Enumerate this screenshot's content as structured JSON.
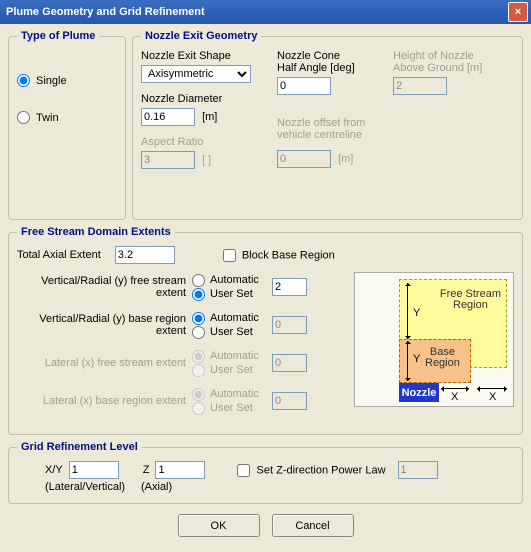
{
  "title": "Plume Geometry and Grid Refinement",
  "plume": {
    "legend": "Type of Plume",
    "single": "Single",
    "twin": "Twin",
    "selected": "single"
  },
  "nozzle": {
    "legend": "Nozzle Exit Geometry",
    "shape_label": "Nozzle Exit Shape",
    "shape_value": "Axisymmetric",
    "diameter_label": "Nozzle Diameter",
    "diameter_value": "0.16",
    "diameter_unit": "[m]",
    "aspect_label": "Aspect Ratio",
    "aspect_value": "3",
    "aspect_unit": "[ ]",
    "cone_label": "Nozzle Cone\nHalf Angle [deg]",
    "cone_value": "0",
    "offset_label": "Nozzle offset from\nvehicle centreline",
    "offset_value": "0",
    "offset_unit": "[m]",
    "height_label": "Height of Nozzle\nAbove Ground [m]",
    "height_value": "2"
  },
  "domain": {
    "legend": "Free Stream Domain Extents",
    "total_axial_label": "Total Axial Extent",
    "total_axial_value": "3.2",
    "block_base_label": "Block Base Region",
    "automatic": "Automatic",
    "userset": "User Set",
    "rows": [
      {
        "label": "Vertical/Radial (y) free stream extent",
        "selected": "userset",
        "value": "2",
        "enabled": true
      },
      {
        "label": "Vertical/Radial (y) base region extent",
        "selected": "automatic",
        "value": "0",
        "enabled": true
      },
      {
        "label": "Lateral (x) free stream extent",
        "selected": "automatic",
        "value": "0",
        "enabled": false
      },
      {
        "label": "Lateral (x) base region extent",
        "selected": "automatic",
        "value": "0",
        "enabled": false
      }
    ],
    "diagram": {
      "fs_label": "Free Stream\nRegion",
      "base_label": "Base\nRegion",
      "nozzle_label": "Nozzle",
      "y": "Y",
      "x": "X"
    }
  },
  "grid": {
    "legend": "Grid Refinement Level",
    "xy_label": "X/Y",
    "xy_value": "1",
    "xy_sub": "(Lateral/Vertical)",
    "z_label": "Z",
    "z_value": "1",
    "z_sub": "(Axial)",
    "power_label": "Set Z-direction Power Law",
    "power_value": "1"
  },
  "buttons": {
    "ok": "OK",
    "cancel": "Cancel"
  }
}
